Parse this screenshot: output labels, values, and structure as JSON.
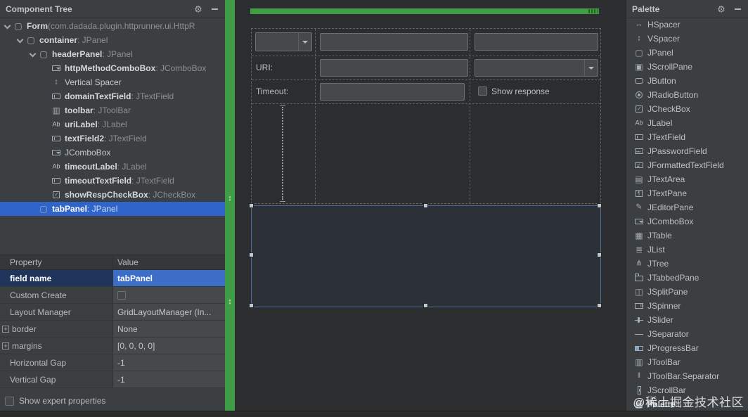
{
  "colors": {
    "panel_bg": "#3c3f41",
    "canvas_bg": "#2b2d2e",
    "accent_green": "#3f9d45",
    "tree_selection_blue": "#2f65ca",
    "value_selection_blue": "#3d6ec6"
  },
  "component_tree": {
    "title": "Component Tree",
    "header_icons": [
      "gear-icon",
      "minimize-icon"
    ],
    "items": [
      {
        "name": "Form",
        "suffix": " (com.dadada.plugin.httprunner.ui.HttpR",
        "icon": "form-icon",
        "level": 0,
        "expanded": true,
        "bold": true
      },
      {
        "name": "container",
        "suffix": " : JPanel",
        "icon": "jpanel-icon",
        "level": 1,
        "expanded": true,
        "bold": true
      },
      {
        "name": "headerPanel",
        "suffix": " : JPanel",
        "icon": "jpanel-icon",
        "level": 2,
        "expanded": true,
        "bold": true
      },
      {
        "name": "httpMethodComboBox",
        "suffix": " : JComboBox",
        "icon": "jcombobox-icon",
        "level": 3,
        "bold": true
      },
      {
        "name": "Vertical Spacer",
        "suffix": "",
        "icon": "vspacer-icon",
        "level": 3,
        "bold": false
      },
      {
        "name": "domainTextField",
        "suffix": " : JTextField",
        "icon": "jtextfield-icon",
        "level": 3,
        "bold": true
      },
      {
        "name": "toolbar",
        "suffix": " : JToolBar",
        "icon": "jtoolbar-icon",
        "level": 3,
        "bold": true
      },
      {
        "name": "uriLabel",
        "suffix": " : JLabel",
        "icon": "jlabel-icon",
        "level": 3,
        "bold": true
      },
      {
        "name": "textField2",
        "suffix": " : JTextField",
        "icon": "jtextfield-icon",
        "level": 3,
        "bold": true
      },
      {
        "name": "JComboBox",
        "suffix": "",
        "icon": "jcombobox-icon",
        "level": 3,
        "bold": false
      },
      {
        "name": "timeoutLabel",
        "suffix": " : JLabel",
        "icon": "jlabel-icon",
        "level": 3,
        "bold": true
      },
      {
        "name": "timeoutTextField",
        "suffix": " : JTextField",
        "icon": "jtextfield-icon",
        "level": 3,
        "bold": true
      },
      {
        "name": "showRespCheckBox",
        "suffix": " : JCheckBox",
        "icon": "jcheckbox-checked-icon",
        "level": 3,
        "bold": true
      },
      {
        "name": "tabPanel",
        "suffix": " : JPanel",
        "icon": "jpanel-icon",
        "level": 2,
        "bold": true,
        "selected": true
      }
    ]
  },
  "inspector": {
    "columns": [
      "Property",
      "Value"
    ],
    "rows": [
      {
        "property": "field name",
        "value": "tabPanel",
        "selected": true
      },
      {
        "property": "Custom Create",
        "value_checkbox": false
      },
      {
        "property": "Layout Manager",
        "value": "GridLayoutManager (In..."
      },
      {
        "property": "border",
        "value": "None",
        "expandable": true
      },
      {
        "property": "margins",
        "value": "[0, 0, 0, 0]",
        "expandable": true
      },
      {
        "property": "Horizontal Gap",
        "value": "-1"
      },
      {
        "property": "Vertical Gap",
        "value": "-1"
      }
    ],
    "show_expert_label": "Show expert properties",
    "show_expert_checked": false
  },
  "designer": {
    "uri_label": "URI:",
    "timeout_label": "Timeout:",
    "show_response_label": "Show response",
    "show_response_checked": false,
    "selected_component": "tabPanel"
  },
  "palette": {
    "title": "Palette",
    "header_icons": [
      "gear-icon",
      "minimize-icon"
    ],
    "items": [
      {
        "label": "HSpacer",
        "icon": "hspacer-icon"
      },
      {
        "label": "VSpacer",
        "icon": "vspacer-icon"
      },
      {
        "label": "JPanel",
        "icon": "jpanel-icon"
      },
      {
        "label": "JScrollPane",
        "icon": "jscrollpane-icon"
      },
      {
        "label": "JButton",
        "icon": "jbutton-icon"
      },
      {
        "label": "JRadioButton",
        "icon": "jradiobutton-icon"
      },
      {
        "label": "JCheckBox",
        "icon": "jcheckbox-icon"
      },
      {
        "label": "JLabel",
        "icon": "jlabel-icon"
      },
      {
        "label": "JTextField",
        "icon": "jtextfield-icon"
      },
      {
        "label": "JPasswordField",
        "icon": "jpasswordfield-icon"
      },
      {
        "label": "JFormattedTextField",
        "icon": "jformattedtextfield-icon"
      },
      {
        "label": "JTextArea",
        "icon": "jtextarea-icon"
      },
      {
        "label": "JTextPane",
        "icon": "jtextpane-icon"
      },
      {
        "label": "JEditorPane",
        "icon": "jeditorpane-icon"
      },
      {
        "label": "JComboBox",
        "icon": "jcombobox-icon"
      },
      {
        "label": "JTable",
        "icon": "jtable-icon"
      },
      {
        "label": "JList",
        "icon": "jlist-icon"
      },
      {
        "label": "JTree",
        "icon": "jtree-icon"
      },
      {
        "label": "JTabbedPane",
        "icon": "jtabbedpane-icon"
      },
      {
        "label": "JSplitPane",
        "icon": "jsplitpane-icon"
      },
      {
        "label": "JSpinner",
        "icon": "jspinner-icon"
      },
      {
        "label": "JSlider",
        "icon": "jslider-icon"
      },
      {
        "label": "JSeparator",
        "icon": "jseparator-icon"
      },
      {
        "label": "JProgressBar",
        "icon": "jprogressbar-icon"
      },
      {
        "label": "JToolBar",
        "icon": "jtoolbar-icon"
      },
      {
        "label": "JToolBar.Separator",
        "icon": "jtoolbarseparator-icon"
      },
      {
        "label": "JScrollBar",
        "icon": "jscrollbar-icon"
      },
      {
        "label": "Palette",
        "icon": "palette-icon",
        "group": true
      }
    ]
  },
  "watermark": "@稀土掘金技术社区"
}
